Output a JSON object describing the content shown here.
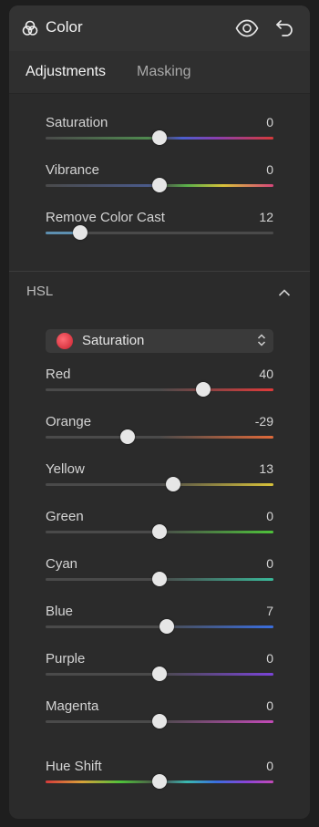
{
  "header": {
    "title": "Color",
    "icons": [
      "color-circles-icon",
      "eye-icon",
      "undo-icon"
    ]
  },
  "tabs": [
    {
      "label": "Adjustments",
      "active": true
    },
    {
      "label": "Masking",
      "active": false
    }
  ],
  "basic": [
    {
      "label": "Saturation",
      "value": "0",
      "fraction": 0.5
    },
    {
      "label": "Vibrance",
      "value": "0",
      "fraction": 0.5
    },
    {
      "label": "Remove Color Cast",
      "value": "12",
      "fraction": 0.15
    }
  ],
  "hsl": {
    "label": "HSL",
    "mode": {
      "selected": "Saturation",
      "swatch_color": "#e0434f"
    },
    "sliders": [
      {
        "label": "Red",
        "value": "40",
        "fraction": 0.69,
        "color": "#e03a3a"
      },
      {
        "label": "Orange",
        "value": "-29",
        "fraction": 0.36,
        "color": "#e06a3a"
      },
      {
        "label": "Yellow",
        "value": "13",
        "fraction": 0.56,
        "color": "#d8c23a"
      },
      {
        "label": "Green",
        "value": "0",
        "fraction": 0.5,
        "color": "#4ec23a"
      },
      {
        "label": "Cyan",
        "value": "0",
        "fraction": 0.5,
        "color": "#3ab99a"
      },
      {
        "label": "Blue",
        "value": "7",
        "fraction": 0.53,
        "color": "#3a6ee0"
      },
      {
        "label": "Purple",
        "value": "0",
        "fraction": 0.5,
        "color": "#7a44d8"
      },
      {
        "label": "Magenta",
        "value": "0",
        "fraction": 0.5,
        "color": "#c34ab8"
      }
    ],
    "hue_shift": {
      "label": "Hue Shift",
      "value": "0",
      "fraction": 0.5
    }
  }
}
